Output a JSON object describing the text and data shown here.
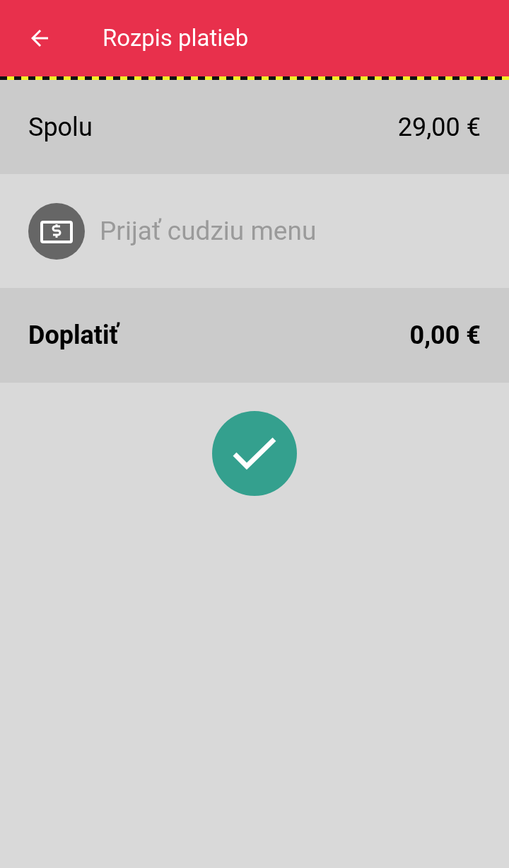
{
  "header": {
    "title": "Rozpis platieb"
  },
  "total": {
    "label": "Spolu",
    "value": "29,00 €"
  },
  "currency_option": {
    "label": "Prijať cudziu menu",
    "disabled": true
  },
  "due": {
    "label": "Doplatiť",
    "value": "0,00 €"
  }
}
